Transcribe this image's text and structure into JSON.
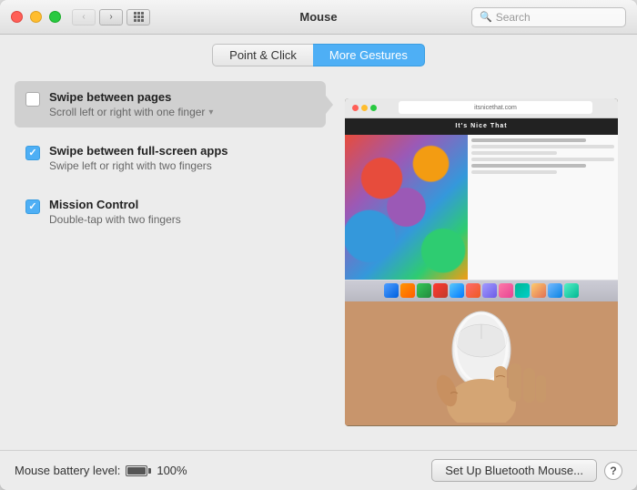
{
  "window": {
    "title": "Mouse"
  },
  "titlebar": {
    "title": "Mouse",
    "back_button": "‹",
    "forward_button": "›"
  },
  "search": {
    "placeholder": "Search"
  },
  "tabs": [
    {
      "id": "point-click",
      "label": "Point & Click",
      "active": false
    },
    {
      "id": "more-gestures",
      "label": "More Gestures",
      "active": true
    }
  ],
  "options": [
    {
      "id": "swipe-pages",
      "title": "Swipe between pages",
      "description": "Scroll left or right with one finger",
      "checked": false,
      "has_dropdown": true,
      "selected": true
    },
    {
      "id": "swipe-fullscreen",
      "title": "Swipe between full-screen apps",
      "description": "Swipe left or right with two fingers",
      "checked": true,
      "has_dropdown": false,
      "selected": false
    },
    {
      "id": "mission-control",
      "title": "Mission Control",
      "description": "Double-tap with two fingers",
      "checked": true,
      "has_dropdown": false,
      "selected": false
    }
  ],
  "footer": {
    "battery_label": "Mouse battery level:",
    "battery_percent": "100%",
    "setup_button": "Set Up Bluetooth Mouse...",
    "help_button": "?"
  },
  "site": {
    "url": "itsnicethat.com",
    "title": "It's Nice That"
  }
}
